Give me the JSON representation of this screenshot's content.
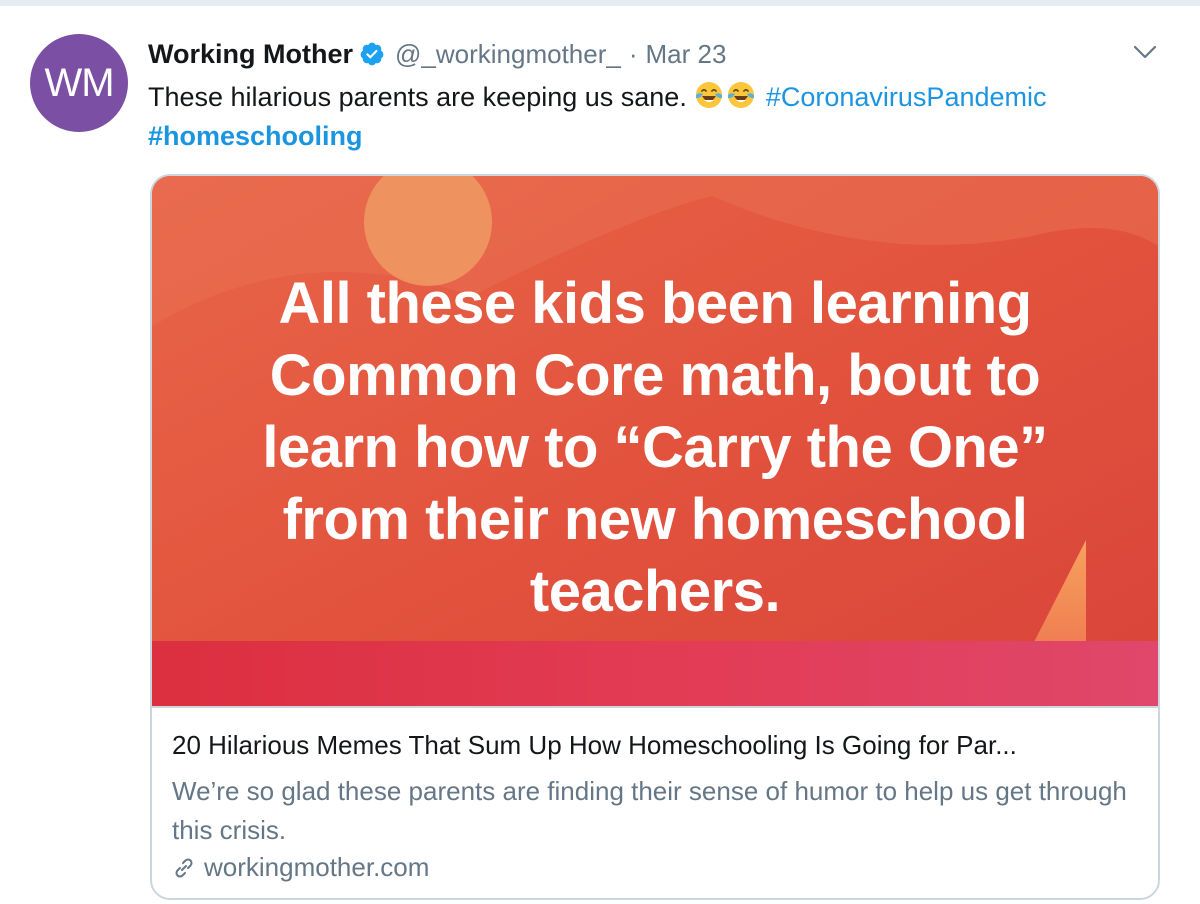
{
  "tweet": {
    "avatar_text": "WM",
    "author_name": "Working Mother",
    "handle": "@_workingmother_",
    "separator": "·",
    "date": "Mar 23",
    "text_main": "These hilarious parents are keeping us sane.",
    "emojis": [
      "face-with-tears-of-joy",
      "face-with-tears-of-joy"
    ],
    "hashtag_1": "#CoronavirusPandemic",
    "hashtag_2": "#homeschooling"
  },
  "card": {
    "meme_line_1": "All these kids been learning",
    "meme_line_2": "Common Core math, bout to",
    "meme_line_3": "learn how to “Carry the One”",
    "meme_line_4": "from their new homeschool",
    "meme_line_5": "teachers.",
    "title": "20 Hilarious Memes That Sum Up How Homeschooling Is Going for Par...",
    "description": "We’re so glad these parents are finding their sense of humor to help us get through this crisis.",
    "domain": "workingmother.com"
  },
  "icons": {
    "verified": "verified-badge-icon",
    "caret": "chevron-down-icon",
    "link": "link-icon"
  },
  "colors": {
    "avatar": "#7b4fa3",
    "link_blue": "#1b95e0",
    "meme_background": "#e2573d",
    "meme_band": "#e03e52",
    "secondary_text": "#657786"
  }
}
